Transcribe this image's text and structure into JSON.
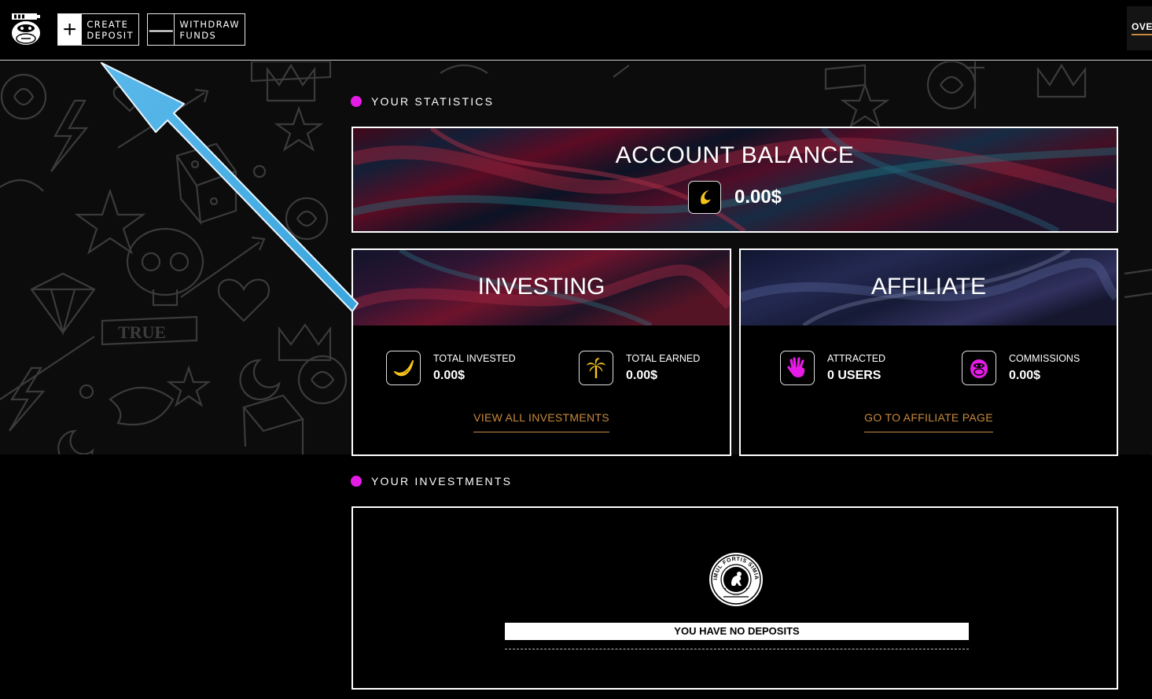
{
  "header": {
    "create_btn": {
      "line1": "CREATE",
      "line2": "DEPOSIT",
      "symbol": "+"
    },
    "withdraw_btn": {
      "line1": "WITHDRAW",
      "line2": "FUNDS",
      "symbol": "—"
    },
    "nav_overview": "OVER"
  },
  "statistics": {
    "section_title": "YOUR STATISTICS",
    "balance": {
      "title": "ACCOUNT BALANCE",
      "amount": "0.00$",
      "icon": "moon-banana-icon"
    },
    "investing": {
      "title": "INVESTING",
      "total_invested_label": "TOTAL INVESTED",
      "total_invested_value": "0.00$",
      "total_earned_label": "TOTAL EARNED",
      "total_earned_value": "0.00$",
      "link": "VIEW ALL INVESTMENTS"
    },
    "affiliate": {
      "title": "AFFILIATE",
      "attracted_label": "ATTRACTED",
      "attracted_value": "0 USERS",
      "commissions_label": "COMMISSIONS",
      "commissions_value": "0.00$",
      "link": "GO TO AFFILIATE PAGE"
    }
  },
  "investments": {
    "section_title": "YOUR INVESTMENTS",
    "empty_message": "YOU HAVE NO DEPOSITS",
    "seal_text": "SIMUL FORTIS SIMIAE"
  },
  "colors": {
    "accent_magenta": "#e51ce5",
    "accent_gold": "#c8893c",
    "icon_yellow": "#f5c51c"
  }
}
